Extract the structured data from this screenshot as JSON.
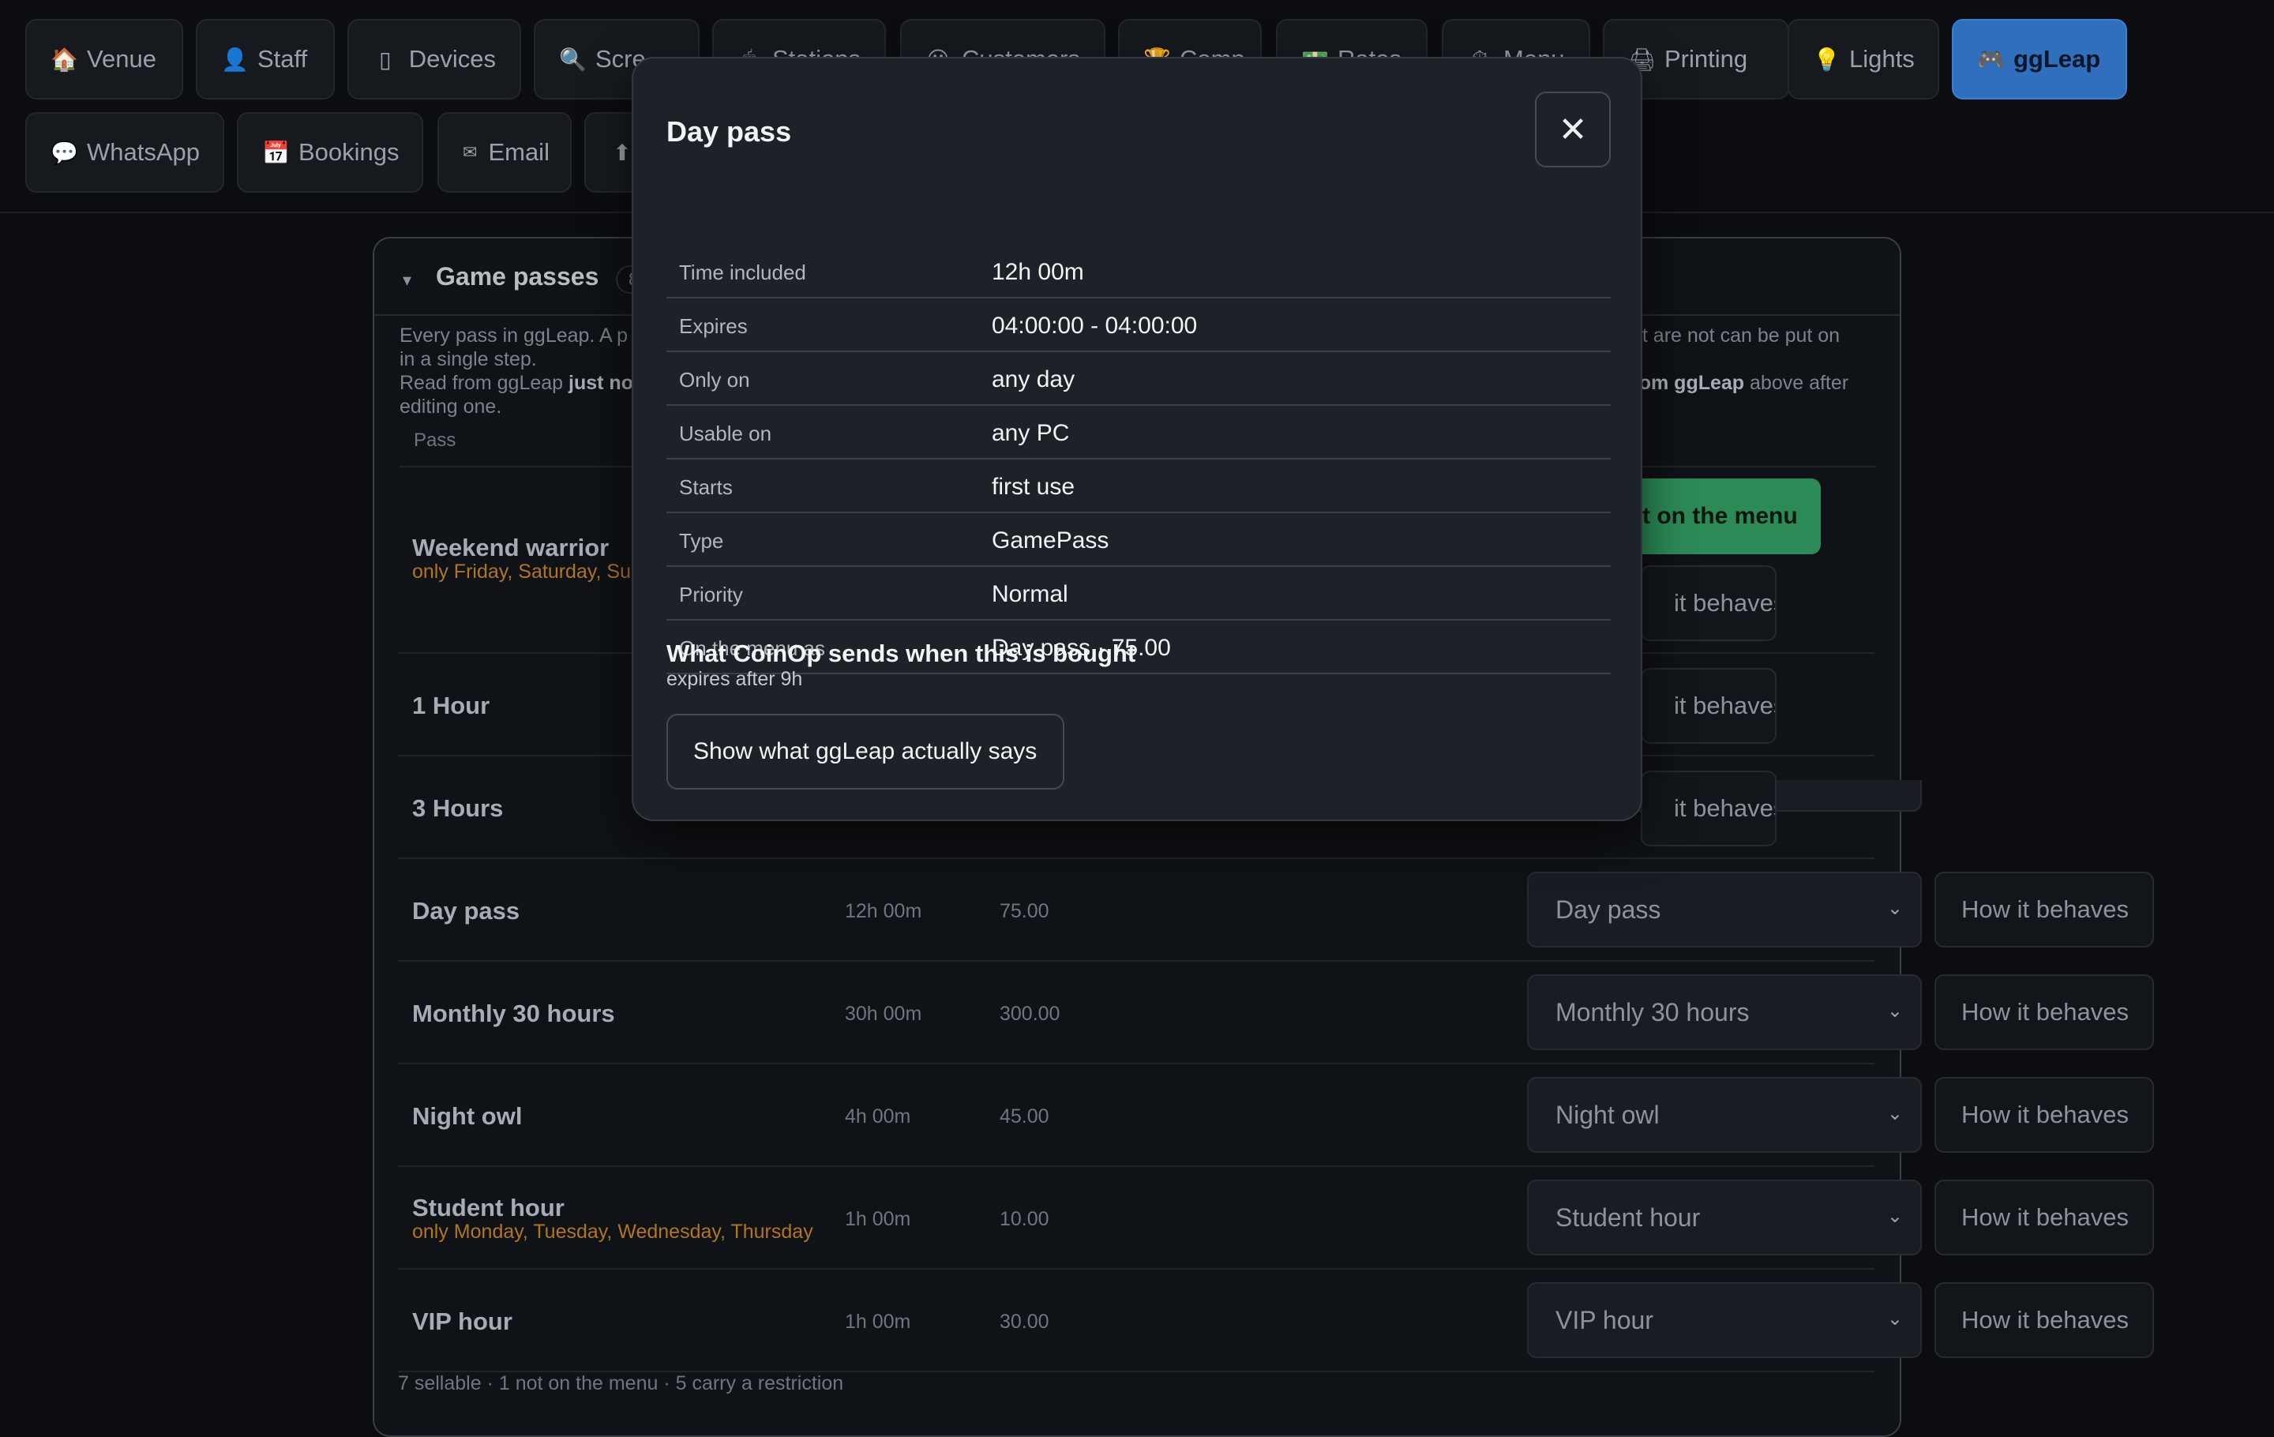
{
  "nav": {
    "row1": [
      {
        "label": "Venue",
        "icon": "🏠"
      },
      {
        "label": "Staff",
        "icon": "👤"
      },
      {
        "label": "Devices",
        "icon": "▯"
      },
      {
        "label": "Scre",
        "icon": "🔍"
      },
      {
        "label": "Stations",
        "icon": "🖱"
      },
      {
        "label": "Customers",
        "icon": "😀"
      },
      {
        "label": "Comp",
        "icon": "🏆"
      },
      {
        "label": "Rates",
        "icon": "💵"
      },
      {
        "label": "Menu",
        "icon": "⏱"
      },
      {
        "label": "Printing",
        "icon": "🖨"
      },
      {
        "label": "Lights",
        "icon": "💡"
      },
      {
        "label": "ggLeap",
        "icon": "🎮",
        "active": true
      }
    ],
    "row2": [
      {
        "label": "WhatsApp",
        "icon": "💬"
      },
      {
        "label": "Bookings",
        "icon": "📅"
      },
      {
        "label": "Email",
        "icon": "✉"
      },
      {
        "label": "",
        "icon": "⬆"
      }
    ]
  },
  "panel": {
    "title": "Game passes",
    "count": "8",
    "desc_line1": "Every pass in ggLeap. A p",
    "desc_line2": "in a single step.",
    "desc_line3_a": "Read from ggLeap ",
    "desc_line3_b": "just no",
    "desc_line4": "editing one.",
    "desc_right_1": "at are not can be put on",
    "desc_right_2a": "rom ggLeap",
    "desc_right_2b": " above after",
    "col_pass": "Pass",
    "menu_button": "t on the menu",
    "behave_partial": "it behaves",
    "behave_label": "How it behaves",
    "rows": [
      {
        "name": "Weekend warrior",
        "restrict": "only Friday, Saturday, Su"
      },
      {
        "name": "1 Hour"
      },
      {
        "name": "3 Hours"
      },
      {
        "name": "Day pass",
        "time": "12h 00m",
        "price": "75.00",
        "menu": "Day pass"
      },
      {
        "name": "Monthly 30 hours",
        "time": "30h 00m",
        "price": "300.00",
        "menu": "Monthly 30 hours"
      },
      {
        "name": "Night owl",
        "time": "4h 00m",
        "price": "45.00",
        "menu": "Night owl"
      },
      {
        "name": "Student hour",
        "restrict": "only Monday, Tuesday, Wednesday, Thursday",
        "time": "1h 00m",
        "price": "10.00",
        "menu": "Student hour"
      },
      {
        "name": "VIP hour",
        "time": "1h 00m",
        "price": "30.00",
        "menu": "VIP hour"
      }
    ],
    "footer": "7 sellable · 1 not on the menu · 5 carry a restriction"
  },
  "modal": {
    "title": "Day pass",
    "close_icon": "✕",
    "details": [
      {
        "k": "Time included",
        "v": "12h 00m"
      },
      {
        "k": "Expires",
        "v": "04:00:00 - 04:00:00"
      },
      {
        "k": "Only on",
        "v": "any day"
      },
      {
        "k": "Usable on",
        "v": "any PC"
      },
      {
        "k": "Starts",
        "v": "first use"
      },
      {
        "k": "Type",
        "v": "GamePass"
      },
      {
        "k": "Priority",
        "v": "Normal"
      },
      {
        "k": "On the menu as",
        "v": "Day pass · 75.00"
      }
    ],
    "sends_title": "What CoinOp sends when this is bought",
    "sends_sub": "expires after 9h",
    "show_button": "Show what ggLeap actually says"
  }
}
